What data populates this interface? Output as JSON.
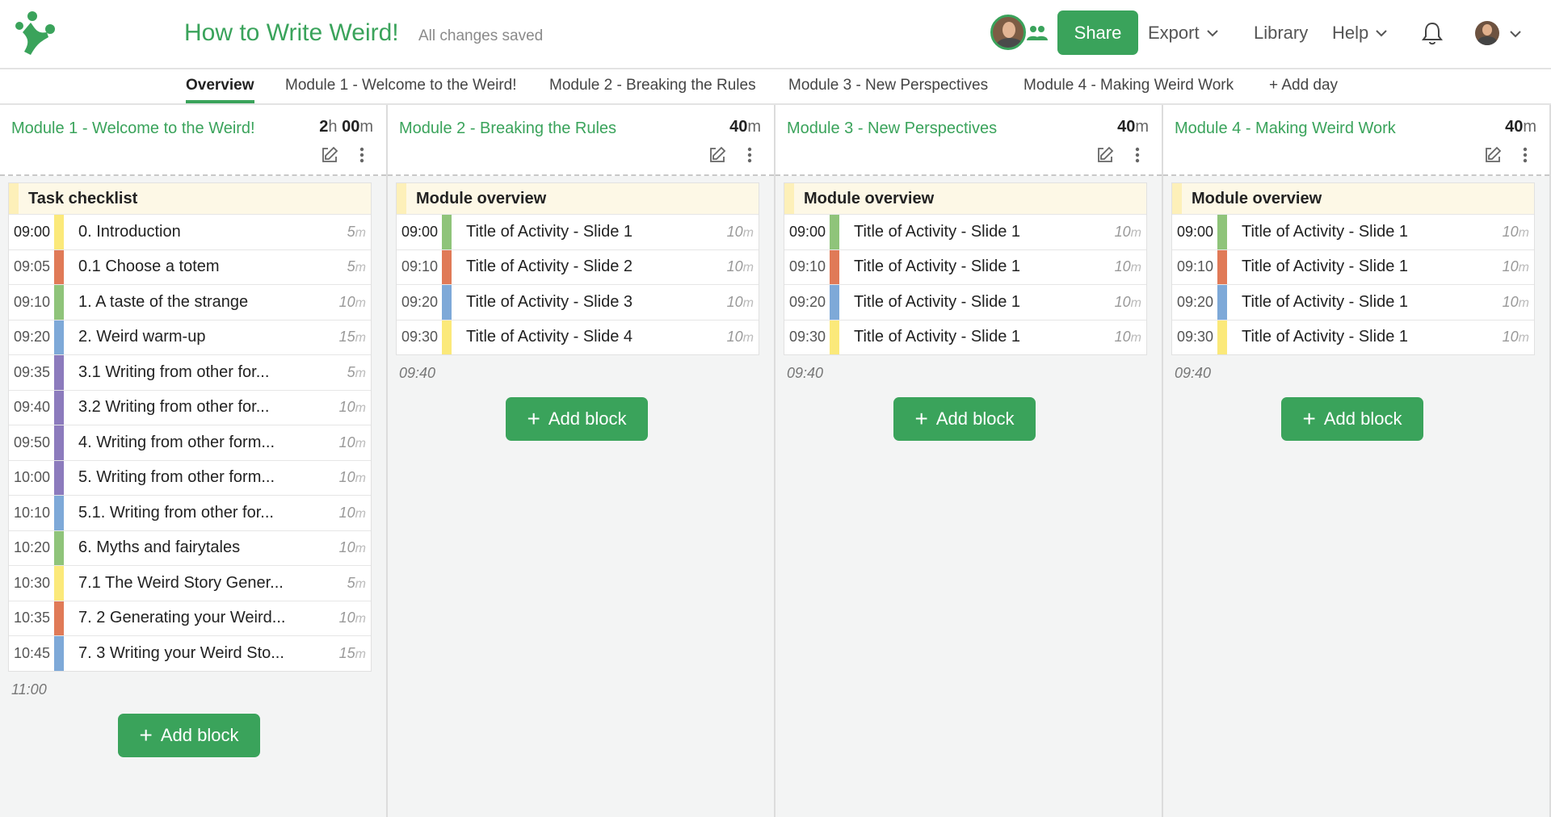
{
  "header": {
    "title": "How to Write Weird!",
    "save_status": "All changes saved",
    "share_label": "Share",
    "export_label": "Export",
    "library_label": "Library",
    "help_label": "Help"
  },
  "tabs": [
    {
      "label": "Overview"
    },
    {
      "label": "Module 1 - Welcome to the Weird!"
    },
    {
      "label": "Module 2 - Breaking the Rules"
    },
    {
      "label": "Module 3 - New Perspectives"
    },
    {
      "label": "Module 4 - Making Weird Work"
    },
    {
      "label": "+ Add day"
    }
  ],
  "colors": {
    "brand": "#3aa35b",
    "yellow": "#fbe97a",
    "red": "#e07a57",
    "green": "#8fc47a",
    "blue": "#7ea9d8",
    "purple": "#8c7bbd"
  },
  "add_block_label": "Add block",
  "columns": [
    {
      "title": "Module 1 - Welcome to the Weird!",
      "duration_h": "2",
      "duration_h_unit": "h",
      "duration_m": "00",
      "duration_m_unit": "m",
      "block_title": "Task checklist",
      "end_time": "11:00",
      "items": [
        {
          "time": "09:00",
          "label": "0. Introduction",
          "dur": "5",
          "unit": "m",
          "color": "yellow"
        },
        {
          "time": "09:05",
          "label": "0.1 Choose a totem",
          "dur": "5",
          "unit": "m",
          "color": "red"
        },
        {
          "time": "09:10",
          "label": "1. A taste of the strange",
          "dur": "10",
          "unit": "m",
          "color": "green"
        },
        {
          "time": "09:20",
          "label": "2. Weird warm-up",
          "dur": "15",
          "unit": "m",
          "color": "blue"
        },
        {
          "time": "09:35",
          "label": "3.1 Writing from other for...",
          "dur": "5",
          "unit": "m",
          "color": "purple"
        },
        {
          "time": "09:40",
          "label": "3.2 Writing from other for...",
          "dur": "10",
          "unit": "m",
          "color": "purple"
        },
        {
          "time": "09:50",
          "label": "4. Writing from other form...",
          "dur": "10",
          "unit": "m",
          "color": "purple"
        },
        {
          "time": "10:00",
          "label": "5. Writing from other form...",
          "dur": "10",
          "unit": "m",
          "color": "purple"
        },
        {
          "time": "10:10",
          "label": "5.1. Writing from other for...",
          "dur": "10",
          "unit": "m",
          "color": "blue"
        },
        {
          "time": "10:20",
          "label": "6. Myths and fairytales",
          "dur": "10",
          "unit": "m",
          "color": "green"
        },
        {
          "time": "10:30",
          "label": "7.1 The Weird Story Gener...",
          "dur": "5",
          "unit": "m",
          "color": "yellow"
        },
        {
          "time": "10:35",
          "label": "7. 2 Generating your Weird...",
          "dur": "10",
          "unit": "m",
          "color": "red"
        },
        {
          "time": "10:45",
          "label": "7. 3 Writing your Weird Sto...",
          "dur": "15",
          "unit": "m",
          "color": "blue"
        }
      ]
    },
    {
      "title": "Module 2 - Breaking the Rules",
      "duration_m": "40",
      "duration_m_unit": "m",
      "block_title": "Module overview",
      "end_time": "09:40",
      "items": [
        {
          "time": "09:00",
          "label": "Title of Activity - Slide 1",
          "dur": "10",
          "unit": "m",
          "color": "green"
        },
        {
          "time": "09:10",
          "label": "Title of Activity - Slide 2",
          "dur": "10",
          "unit": "m",
          "color": "red"
        },
        {
          "time": "09:20",
          "label": "Title of Activity - Slide 3",
          "dur": "10",
          "unit": "m",
          "color": "blue"
        },
        {
          "time": "09:30",
          "label": "Title of Activity - Slide 4",
          "dur": "10",
          "unit": "m",
          "color": "yellow"
        }
      ]
    },
    {
      "title": "Module 3 - New Perspectives",
      "duration_m": "40",
      "duration_m_unit": "m",
      "block_title": "Module overview",
      "end_time": "09:40",
      "items": [
        {
          "time": "09:00",
          "label": "Title of Activity - Slide 1",
          "dur": "10",
          "unit": "m",
          "color": "green"
        },
        {
          "time": "09:10",
          "label": "Title of Activity - Slide 1",
          "dur": "10",
          "unit": "m",
          "color": "red"
        },
        {
          "time": "09:20",
          "label": "Title of Activity - Slide 1",
          "dur": "10",
          "unit": "m",
          "color": "blue"
        },
        {
          "time": "09:30",
          "label": "Title of Activity - Slide 1",
          "dur": "10",
          "unit": "m",
          "color": "yellow"
        }
      ]
    },
    {
      "title": "Module 4 - Making Weird Work",
      "duration_m": "40",
      "duration_m_unit": "m",
      "block_title": "Module overview",
      "end_time": "09:40",
      "items": [
        {
          "time": "09:00",
          "label": "Title of Activity - Slide 1",
          "dur": "10",
          "unit": "m",
          "color": "green"
        },
        {
          "time": "09:10",
          "label": "Title of Activity - Slide 1",
          "dur": "10",
          "unit": "m",
          "color": "red"
        },
        {
          "time": "09:20",
          "label": "Title of Activity - Slide 1",
          "dur": "10",
          "unit": "m",
          "color": "blue"
        },
        {
          "time": "09:30",
          "label": "Title of Activity - Slide 1",
          "dur": "10",
          "unit": "m",
          "color": "yellow"
        }
      ]
    }
  ]
}
